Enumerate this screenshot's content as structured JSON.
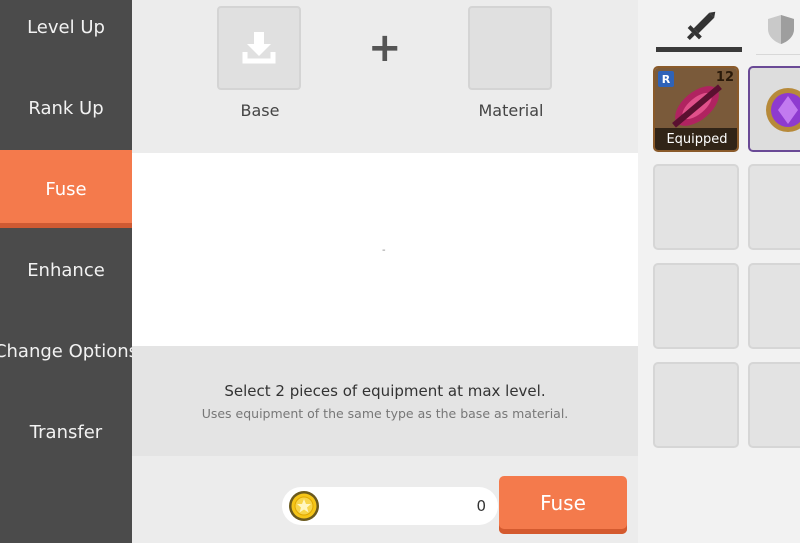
{
  "sidebar": {
    "items": [
      {
        "label": "Level Up"
      },
      {
        "label": "Rank Up"
      },
      {
        "label": "Fuse"
      },
      {
        "label": "Enhance"
      },
      {
        "label": "Change Options"
      },
      {
        "label": "Transfer"
      }
    ],
    "active_index": 2
  },
  "fuse": {
    "base_label": "Base",
    "material_label": "Material",
    "preview_placeholder": "-",
    "hint_main": "Select 2 pieces of equipment at max level.",
    "hint_sub": "Uses equipment of the same type as the base as material.",
    "cost": "0",
    "button_label": "Fuse"
  },
  "inventory": {
    "tabs": [
      {
        "icon": "sword-icon",
        "active": true
      },
      {
        "icon": "shield-icon",
        "active": false
      }
    ],
    "items": [
      {
        "rank": "R",
        "level": "12",
        "status": "Equipped",
        "icon": "weapon-item-icon"
      },
      {
        "icon": "gem-item-icon"
      }
    ]
  },
  "colors": {
    "accent": "#f47a4c",
    "sidebar_bg": "#4b4b4b",
    "gold": "#f5c518"
  }
}
